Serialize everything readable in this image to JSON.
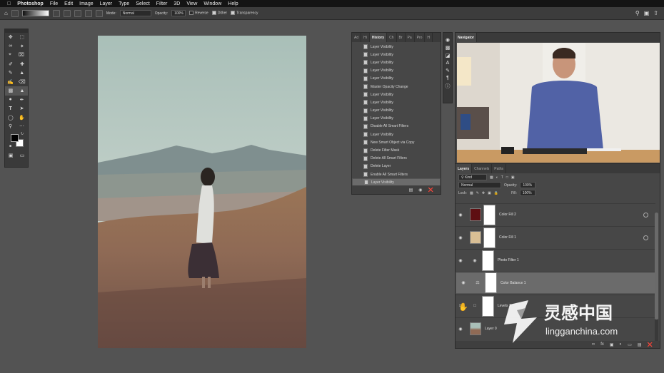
{
  "menubar": {
    "app_name": "Photoshop",
    "items": [
      "File",
      "Edit",
      "Image",
      "Layer",
      "Type",
      "Select",
      "Filter",
      "3D",
      "View",
      "Window",
      "Help"
    ]
  },
  "options": {
    "mode_label": "Mode:",
    "mode_value": "Normal",
    "opacity_label": "Opacity:",
    "opacity_value": "100%",
    "reverse_label": "Reverse",
    "dither_label": "Dither",
    "transparency_label": "Transparency"
  },
  "history": {
    "tabs": [
      "Ad",
      "Hi",
      "History",
      "Ch",
      "Br",
      "Pa",
      "Pro",
      "H"
    ],
    "items": [
      "Layer Visibility",
      "Layer Visibility",
      "Layer Visibility",
      "Layer Visibility",
      "Layer Visibility",
      "Master Opacity Change",
      "Layer Visibility",
      "Layer Visibility",
      "Layer Visibility",
      "Layer Visibility",
      "Disable All Smart Filters",
      "Layer Visibility",
      "New Smart Object via Copy",
      "Delete Filter Mask",
      "Delete All Smart Filters",
      "Delete Layer",
      "Enable All Smart Filters",
      "Layer Visibility"
    ],
    "selected_index": 17
  },
  "navigator": {
    "title": "Navigator"
  },
  "layers_panel": {
    "tabs": [
      "Layers",
      "Channels",
      "Paths"
    ],
    "kind_label": "Kind",
    "blend_mode": "Normal",
    "opacity_label": "Opacity:",
    "opacity_value": "100%",
    "lock_label": "Lock:",
    "fill_label": "Fill:",
    "fill_value": "100%",
    "layers": [
      {
        "name": "Color Fill 2",
        "thumb_color": "#5e0f12"
      },
      {
        "name": "Color Fill 1",
        "thumb_color": "#d9bf95"
      },
      {
        "name": "Photo Filter 1",
        "thumb_color": ""
      },
      {
        "name": "Color Balance 1",
        "thumb_color": ""
      },
      {
        "name": "Levels 1",
        "thumb_color": ""
      },
      {
        "name": "Layer 0",
        "thumb_color": ""
      }
    ],
    "selected_index": 3
  },
  "watermark": {
    "cn_text": "灵感中国",
    "url_text": "lingganchina.com"
  },
  "colors": {
    "accent": "#1c7ed6",
    "panel_bg": "#474747",
    "workspace": "#535353"
  }
}
